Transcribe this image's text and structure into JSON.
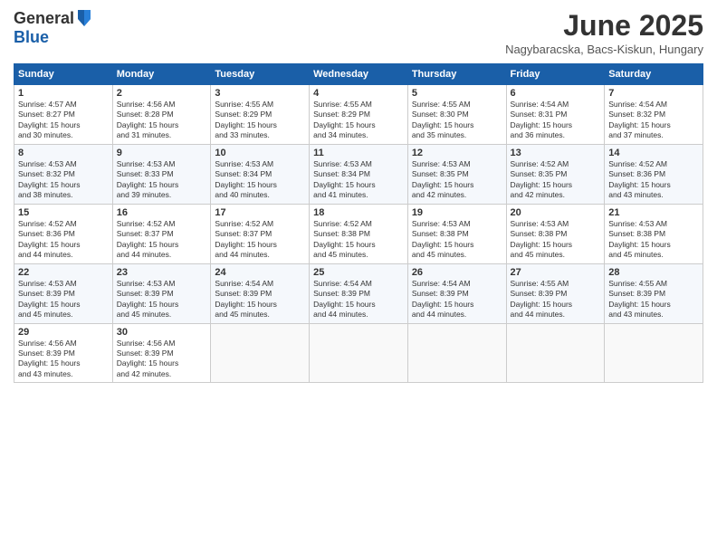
{
  "logo": {
    "general": "General",
    "blue": "Blue"
  },
  "header": {
    "title": "June 2025",
    "location": "Nagybaracska, Bacs-Kiskun, Hungary"
  },
  "days_header": [
    "Sunday",
    "Monday",
    "Tuesday",
    "Wednesday",
    "Thursday",
    "Friday",
    "Saturday"
  ],
  "weeks": [
    [
      {
        "day": "1",
        "sunrise": "4:57 AM",
        "sunset": "8:27 PM",
        "daylight": "15 hours and 30 minutes."
      },
      {
        "day": "2",
        "sunrise": "4:56 AM",
        "sunset": "8:28 PM",
        "daylight": "15 hours and 31 minutes."
      },
      {
        "day": "3",
        "sunrise": "4:55 AM",
        "sunset": "8:29 PM",
        "daylight": "15 hours and 33 minutes."
      },
      {
        "day": "4",
        "sunrise": "4:55 AM",
        "sunset": "8:29 PM",
        "daylight": "15 hours and 34 minutes."
      },
      {
        "day": "5",
        "sunrise": "4:55 AM",
        "sunset": "8:30 PM",
        "daylight": "15 hours and 35 minutes."
      },
      {
        "day": "6",
        "sunrise": "4:54 AM",
        "sunset": "8:31 PM",
        "daylight": "15 hours and 36 minutes."
      },
      {
        "day": "7",
        "sunrise": "4:54 AM",
        "sunset": "8:32 PM",
        "daylight": "15 hours and 37 minutes."
      }
    ],
    [
      {
        "day": "8",
        "sunrise": "4:53 AM",
        "sunset": "8:32 PM",
        "daylight": "15 hours and 38 minutes."
      },
      {
        "day": "9",
        "sunrise": "4:53 AM",
        "sunset": "8:33 PM",
        "daylight": "15 hours and 39 minutes."
      },
      {
        "day": "10",
        "sunrise": "4:53 AM",
        "sunset": "8:34 PM",
        "daylight": "15 hours and 40 minutes."
      },
      {
        "day": "11",
        "sunrise": "4:53 AM",
        "sunset": "8:34 PM",
        "daylight": "15 hours and 41 minutes."
      },
      {
        "day": "12",
        "sunrise": "4:53 AM",
        "sunset": "8:35 PM",
        "daylight": "15 hours and 42 minutes."
      },
      {
        "day": "13",
        "sunrise": "4:52 AM",
        "sunset": "8:35 PM",
        "daylight": "15 hours and 42 minutes."
      },
      {
        "day": "14",
        "sunrise": "4:52 AM",
        "sunset": "8:36 PM",
        "daylight": "15 hours and 43 minutes."
      }
    ],
    [
      {
        "day": "15",
        "sunrise": "4:52 AM",
        "sunset": "8:36 PM",
        "daylight": "15 hours and 44 minutes."
      },
      {
        "day": "16",
        "sunrise": "4:52 AM",
        "sunset": "8:37 PM",
        "daylight": "15 hours and 44 minutes."
      },
      {
        "day": "17",
        "sunrise": "4:52 AM",
        "sunset": "8:37 PM",
        "daylight": "15 hours and 44 minutes."
      },
      {
        "day": "18",
        "sunrise": "4:52 AM",
        "sunset": "8:38 PM",
        "daylight": "15 hours and 45 minutes."
      },
      {
        "day": "19",
        "sunrise": "4:53 AM",
        "sunset": "8:38 PM",
        "daylight": "15 hours and 45 minutes."
      },
      {
        "day": "20",
        "sunrise": "4:53 AM",
        "sunset": "8:38 PM",
        "daylight": "15 hours and 45 minutes."
      },
      {
        "day": "21",
        "sunrise": "4:53 AM",
        "sunset": "8:38 PM",
        "daylight": "15 hours and 45 minutes."
      }
    ],
    [
      {
        "day": "22",
        "sunrise": "4:53 AM",
        "sunset": "8:39 PM",
        "daylight": "15 hours and 45 minutes."
      },
      {
        "day": "23",
        "sunrise": "4:53 AM",
        "sunset": "8:39 PM",
        "daylight": "15 hours and 45 minutes."
      },
      {
        "day": "24",
        "sunrise": "4:54 AM",
        "sunset": "8:39 PM",
        "daylight": "15 hours and 45 minutes."
      },
      {
        "day": "25",
        "sunrise": "4:54 AM",
        "sunset": "8:39 PM",
        "daylight": "15 hours and 44 minutes."
      },
      {
        "day": "26",
        "sunrise": "4:54 AM",
        "sunset": "8:39 PM",
        "daylight": "15 hours and 44 minutes."
      },
      {
        "day": "27",
        "sunrise": "4:55 AM",
        "sunset": "8:39 PM",
        "daylight": "15 hours and 44 minutes."
      },
      {
        "day": "28",
        "sunrise": "4:55 AM",
        "sunset": "8:39 PM",
        "daylight": "15 hours and 43 minutes."
      }
    ],
    [
      {
        "day": "29",
        "sunrise": "4:56 AM",
        "sunset": "8:39 PM",
        "daylight": "15 hours and 43 minutes."
      },
      {
        "day": "30",
        "sunrise": "4:56 AM",
        "sunset": "8:39 PM",
        "daylight": "15 hours and 42 minutes."
      },
      null,
      null,
      null,
      null,
      null
    ]
  ]
}
